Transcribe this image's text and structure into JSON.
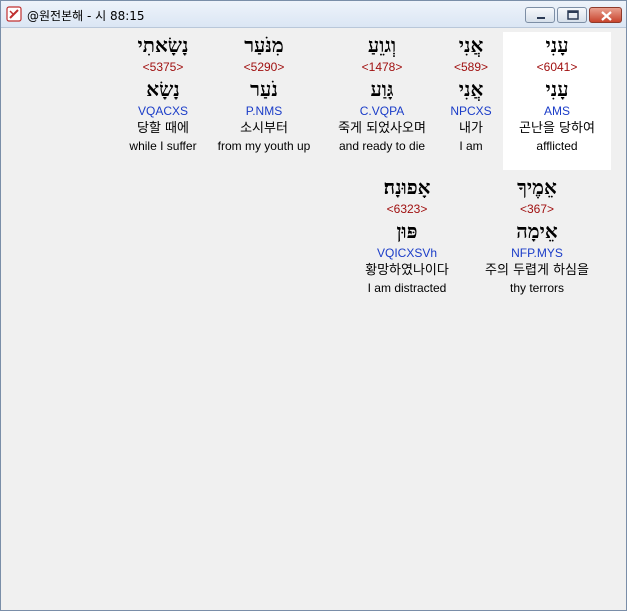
{
  "window": {
    "title": "@원전본해 - 시 88:15",
    "accent": "#1a3cc8",
    "strong_color": "#a01010"
  },
  "words": [
    {
      "hebrew": "עָנִי",
      "strong": "<6041>",
      "lemma": "עָנִי",
      "morph": "AMS",
      "korean": "곤난을 당하여",
      "english": "afflicted"
    },
    {
      "hebrew": "אֲנִי",
      "strong": "<589>",
      "lemma": "אֲנִי",
      "morph": "NPCXS",
      "korean": "내가",
      "english": "I am"
    },
    {
      "hebrew": "וְגוֵעַ",
      "strong": "<1478>",
      "lemma": "גָּוַע",
      "morph": "C.VQPA",
      "korean": "죽게 되었사오며",
      "english": "and ready to die"
    },
    {
      "hebrew": "מִנֹּעַר",
      "strong": "<5290>",
      "lemma": "נֹעַר",
      "morph": "P.NMS",
      "korean": "소시부터",
      "english": "from my youth up"
    },
    {
      "hebrew": "נָשָׂאתִי",
      "strong": "<5375>",
      "lemma": "נָשָׂא",
      "morph": "VQACXS",
      "korean": "당할 때에",
      "english": "while I suffer"
    },
    {
      "hebrew": "אֵמֶיךָ",
      "strong": "<367>",
      "lemma": "אֵימָה",
      "morph": "NFP.MYS",
      "korean": "주의 두렵게 하심을",
      "english": "thy terrors"
    },
    {
      "hebrew": "אָפוּנָה׃",
      "strong": "<6323>",
      "lemma": "פּוּן",
      "morph": "VQICXSVh",
      "korean": "황망하였나이다",
      "english": "I am distracted"
    }
  ]
}
